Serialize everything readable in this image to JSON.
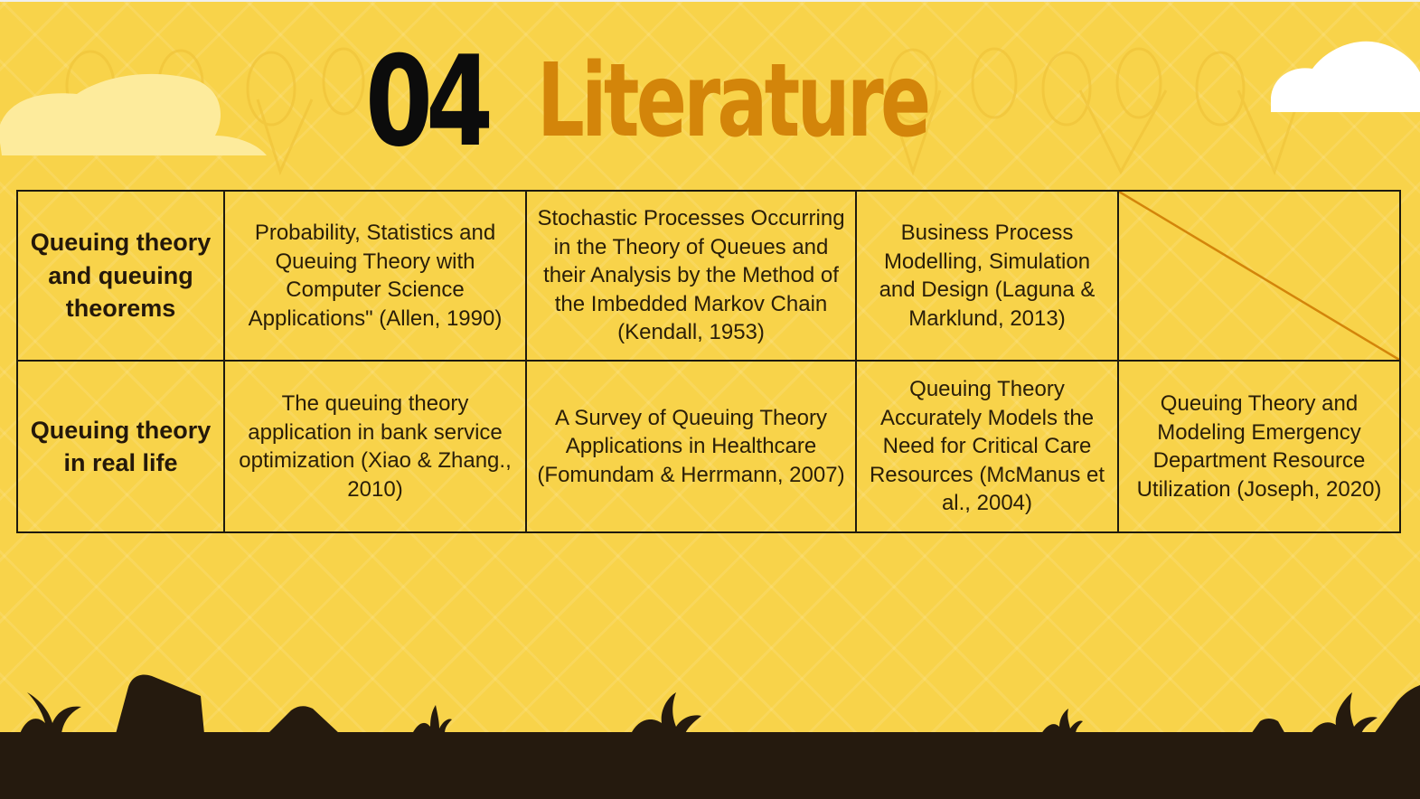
{
  "slide": {
    "number": "04",
    "title": "Literature",
    "colors": {
      "background": "#f8d34a",
      "title_accent": "#d3850a",
      "ground": "#251a0e",
      "cloud_left": "#fdeb9c",
      "cloud_right": "#ffffff"
    }
  },
  "table": {
    "rows": [
      {
        "header": "Queuing theory and queuing theorems",
        "cells": [
          "Probability, Statistics and Queuing Theory with Computer Science Applications\" (Allen, 1990)",
          "Stochastic Processes Occurring in the Theory of Queues and their Analysis by the Method of the Imbedded Markov Chain (Kendall, 1953)",
          "Business Process Modelling, Simulation and Design (Laguna & Marklund, 2013)",
          ""
        ]
      },
      {
        "header": "Queuing theory in real life",
        "cells": [
          "The queuing theory application in bank service optimization (Xiao & Zhang., 2010)",
          "A Survey of Queuing Theory Applications in Healthcare (Fomundam & Herrmann, 2007)",
          "Queuing Theory Accurately Models the Need for Critical Care Resources (McManus et al., 2004)",
          "Queuing Theory and Modeling Emergency Department Resource Utilization (Joseph, 2020)"
        ]
      }
    ]
  }
}
